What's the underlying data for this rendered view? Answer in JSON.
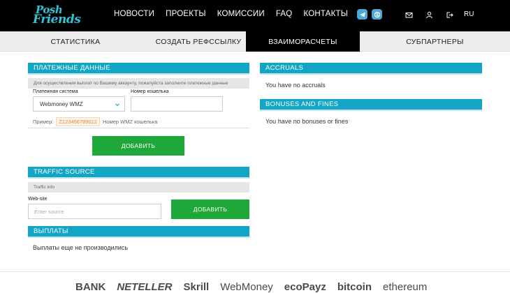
{
  "brand": {
    "line1": "Posh",
    "line2": "Friends"
  },
  "nav": [
    "НОВОСТИ",
    "ПРОЕКТЫ",
    "КОМИССИИ",
    "FAQ",
    "КОНТАКТЫ"
  ],
  "language": "RU",
  "tabs": [
    {
      "label": "СТАТИСТИКА",
      "active": false
    },
    {
      "label": "СОЗДАТЬ РЕФССЫЛКУ",
      "active": false
    },
    {
      "label": "ВЗАИМОРАСЧЕТЫ",
      "active": true
    },
    {
      "label": "СУБПАРТНЕРЫ",
      "active": false
    }
  ],
  "payment": {
    "title": "ПЛАТЕЖНЫЕ ДАННЫЕ",
    "info": "Для осуществления выплат по Вашему аккаунту, пожалуйста заполните платежные данные",
    "system_label": "Платежная система",
    "system_value": "Webmoney WMZ",
    "wallet_label": "Номер кошелька",
    "wallet_value": "",
    "example_label": "Пример:",
    "example_code": "Z123456789012",
    "example_note": "Номер WMZ кошелька",
    "add_button": "ДОБАВИТЬ"
  },
  "traffic": {
    "title": "TRAFFIC SOURCE",
    "info": "Traffic info",
    "website_label": "Web-site",
    "website_placeholder": "Enter source",
    "add_button": "ДОБАВИТЬ"
  },
  "payouts": {
    "title": "ВЫПЛАТЫ",
    "empty": "Выплаты еще не производились"
  },
  "accruals": {
    "title": "ACCRUALS",
    "empty": "You have no accruals"
  },
  "bonuses": {
    "title": "BONUSES AND FINES",
    "empty": "You have no bonuses or fines"
  },
  "footer": {
    "partners": [
      "BANK",
      "NETELLER",
      "Skrill",
      "WebMoney",
      "ecoPayz",
      "bitcoin",
      "ethereum"
    ]
  },
  "colors": {
    "accent": "#13a5c6",
    "button": "#1fa83a",
    "topbar": "#000000"
  }
}
